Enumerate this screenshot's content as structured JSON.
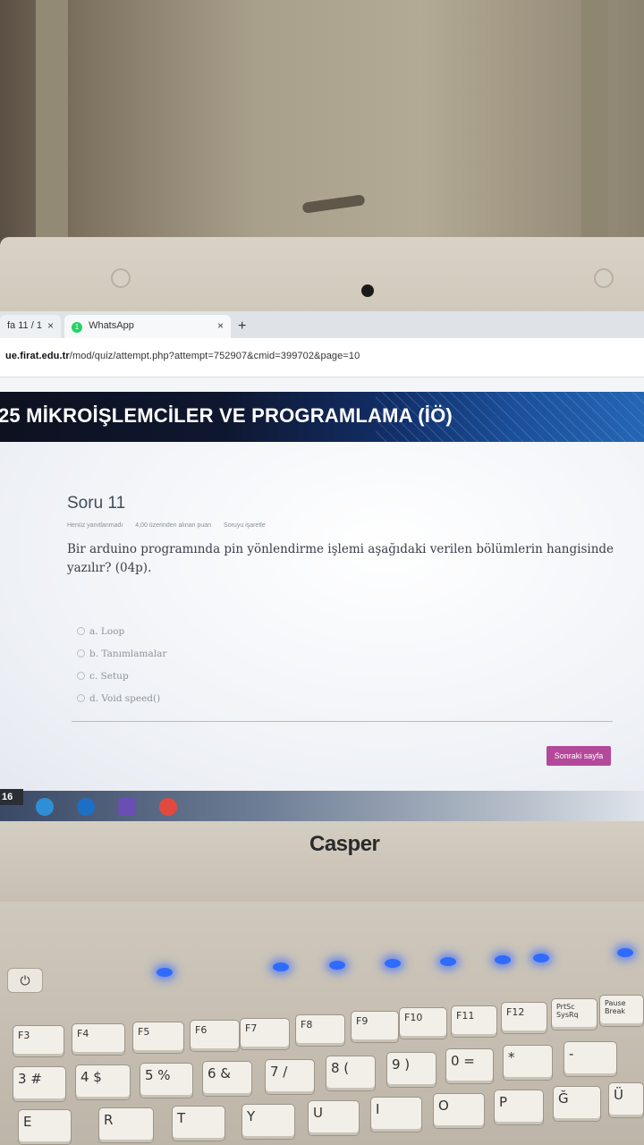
{
  "browser": {
    "tabs": [
      {
        "label": "fa 11 / 1",
        "close": "×"
      },
      {
        "label": "WhatsApp",
        "badge": "1",
        "close": "×"
      }
    ],
    "new_tab": "+",
    "url_domain": "ue.firat.edu.tr",
    "url_path": "/mod/quiz/attempt.php?attempt=752907&cmid=399702&page=10"
  },
  "course": {
    "banner_title": "25 MİKROİŞLEMCİLER VE PROGRAMLAMA (İÖ)"
  },
  "question": {
    "title": "Soru 11",
    "meta": [
      "Henüz yanıtlanmadı",
      "4,00 üzerinden alınan puan",
      "Soruyu işaretle"
    ],
    "text": "Bir arduino programında pin yönlendirme işlemi aşağıdaki verilen bölümlerin hangisinde yazılır? (04p).",
    "options": [
      {
        "label": "a. Loop"
      },
      {
        "label": "b. Tanımlamalar"
      },
      {
        "label": "c. Setup"
      },
      {
        "label": "d. Void speed()"
      }
    ],
    "next_button": "Sonraki sayfa"
  },
  "taskbar": {
    "clock_fragment": "16"
  },
  "laptop": {
    "brand": "Casper",
    "power_glyph": "⏻",
    "function_keys": [
      "F3",
      "F4",
      "F5",
      "F6",
      "F7",
      "F8",
      "F9",
      "F10",
      "F11",
      "F12",
      "PrtSc SysRq",
      "Pause Break"
    ],
    "number_keys": [
      "3 #",
      "4 $",
      "5 %",
      "6 &",
      "7 /",
      "8 (",
      "9 )",
      "0 =",
      "*",
      "-"
    ],
    "letter_keys": [
      "E",
      "R",
      "T",
      "Y",
      "U",
      "I",
      "O",
      "P",
      "Ğ",
      "Ü"
    ]
  },
  "colors": {
    "banner_dark": "#0d1220",
    "banner_blue": "#2566b4",
    "next_button": "#b4489a",
    "led_blue": "#2f6bff"
  }
}
